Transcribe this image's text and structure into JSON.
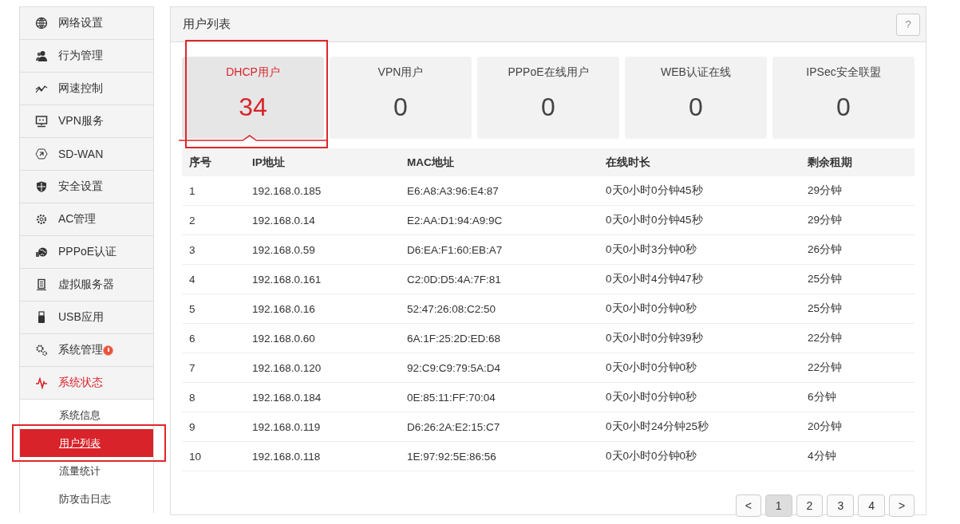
{
  "sidebar": {
    "items": [
      {
        "label": "网络设置",
        "selected": false
      },
      {
        "label": "行为管理",
        "selected": false
      },
      {
        "label": "网速控制",
        "selected": false
      },
      {
        "label": "VPN服务",
        "selected": false
      },
      {
        "label": "SD-WAN",
        "selected": false
      },
      {
        "label": "安全设置",
        "selected": false
      },
      {
        "label": "AC管理",
        "selected": false
      },
      {
        "label": "PPPoE认证",
        "selected": false
      },
      {
        "label": "虚拟服务器",
        "selected": false
      },
      {
        "label": "USB应用",
        "selected": false
      },
      {
        "label": "系统管理",
        "selected": false,
        "alert": true
      },
      {
        "label": "系统状态",
        "selected": true,
        "children": [
          {
            "label": "系统信息",
            "selected": false,
            "highlighted": false
          },
          {
            "label": "用户列表",
            "selected": true,
            "highlighted": true
          },
          {
            "label": "流量统计",
            "selected": false,
            "highlighted": false
          },
          {
            "label": "防攻击日志",
            "selected": false,
            "highlighted": false
          }
        ]
      }
    ]
  },
  "panel": {
    "title": "用户列表",
    "help": "?",
    "cards": [
      {
        "label": "DHCP用户",
        "value": "34",
        "selected": true,
        "highlighted": true
      },
      {
        "label": "VPN用户",
        "value": "0",
        "selected": false,
        "highlighted": false
      },
      {
        "label": "PPPoE在线用户",
        "value": "0",
        "selected": false,
        "highlighted": false
      },
      {
        "label": "WEB认证在线",
        "value": "0",
        "selected": false,
        "highlighted": false
      },
      {
        "label": "IPSec安全联盟",
        "value": "0",
        "selected": false,
        "highlighted": false
      }
    ],
    "table": {
      "columns": [
        "序号",
        "IP地址",
        "MAC地址",
        "在线时长",
        "剩余租期"
      ],
      "rows": [
        [
          "1",
          "192.168.0.185",
          "E6:A8:A3:96:E4:87",
          "0天0小时0分钟45秒",
          "29分钟"
        ],
        [
          "2",
          "192.168.0.14",
          "E2:AA:D1:94:A9:9C",
          "0天0小时0分钟45秒",
          "29分钟"
        ],
        [
          "3",
          "192.168.0.59",
          "D6:EA:F1:60:EB:A7",
          "0天0小时3分钟0秒",
          "26分钟"
        ],
        [
          "4",
          "192.168.0.161",
          "C2:0D:D5:4A:7F:81",
          "0天0小时4分钟47秒",
          "25分钟"
        ],
        [
          "5",
          "192.168.0.16",
          "52:47:26:08:C2:50",
          "0天0小时0分钟0秒",
          "25分钟"
        ],
        [
          "6",
          "192.168.0.60",
          "6A:1F:25:2D:ED:68",
          "0天0小时0分钟39秒",
          "22分钟"
        ],
        [
          "7",
          "192.168.0.120",
          "92:C9:C9:79:5A:D4",
          "0天0小时0分钟0秒",
          "22分钟"
        ],
        [
          "8",
          "192.168.0.184",
          "0E:85:11:FF:70:04",
          "0天0小时0分钟0秒",
          "6分钟"
        ],
        [
          "9",
          "192.168.0.119",
          "D6:26:2A:E2:15:C7",
          "0天0小时24分钟25秒",
          "20分钟"
        ],
        [
          "10",
          "192.168.0.118",
          "1E:97:92:5E:86:56",
          "0天0小时0分钟0秒",
          "4分钟"
        ]
      ]
    },
    "pagination": {
      "prev": "<",
      "next": ">",
      "pages": [
        {
          "label": "1",
          "selected": true
        },
        {
          "label": "2",
          "selected": false
        },
        {
          "label": "3",
          "selected": false
        },
        {
          "label": "4",
          "selected": false
        }
      ]
    }
  }
}
